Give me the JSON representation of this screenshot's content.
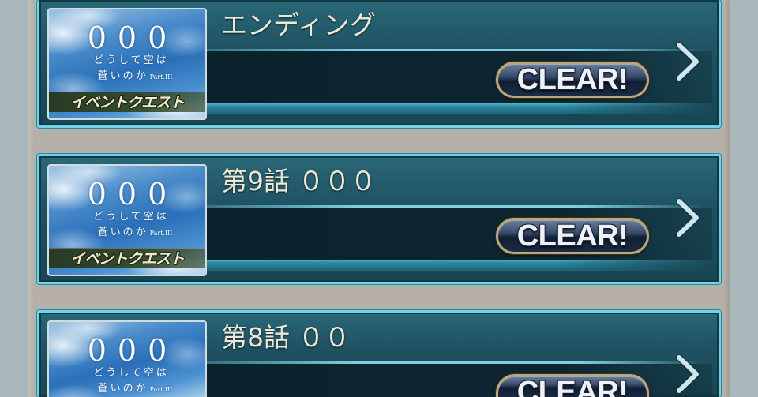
{
  "quests": [
    {
      "title": "エンディング",
      "status": "CLEAR!",
      "thumbnail": {
        "number": "000",
        "line1": "どうして空は",
        "line2": "蒼いのか",
        "part": "Part.III",
        "banner": "イベントクエスト"
      }
    },
    {
      "title": "第9話 ０００",
      "status": "CLEAR!",
      "thumbnail": {
        "number": "000",
        "line1": "どうして空は",
        "line2": "蒼いのか",
        "part": "Part.III",
        "banner": "イベントクエスト"
      }
    },
    {
      "title": "第8話 ００",
      "status": "CLEAR!",
      "thumbnail": {
        "number": "000",
        "line1": "どうして空は",
        "line2": "蒼いのか",
        "part": "Part.III"
      }
    }
  ],
  "icons": {
    "row_arrow": "chevron-right-icon"
  },
  "colors": {
    "card_border": "#72d3e6",
    "title_text": "#ede8d6",
    "clear_border": "#bba77c",
    "banner": "#34482b"
  }
}
